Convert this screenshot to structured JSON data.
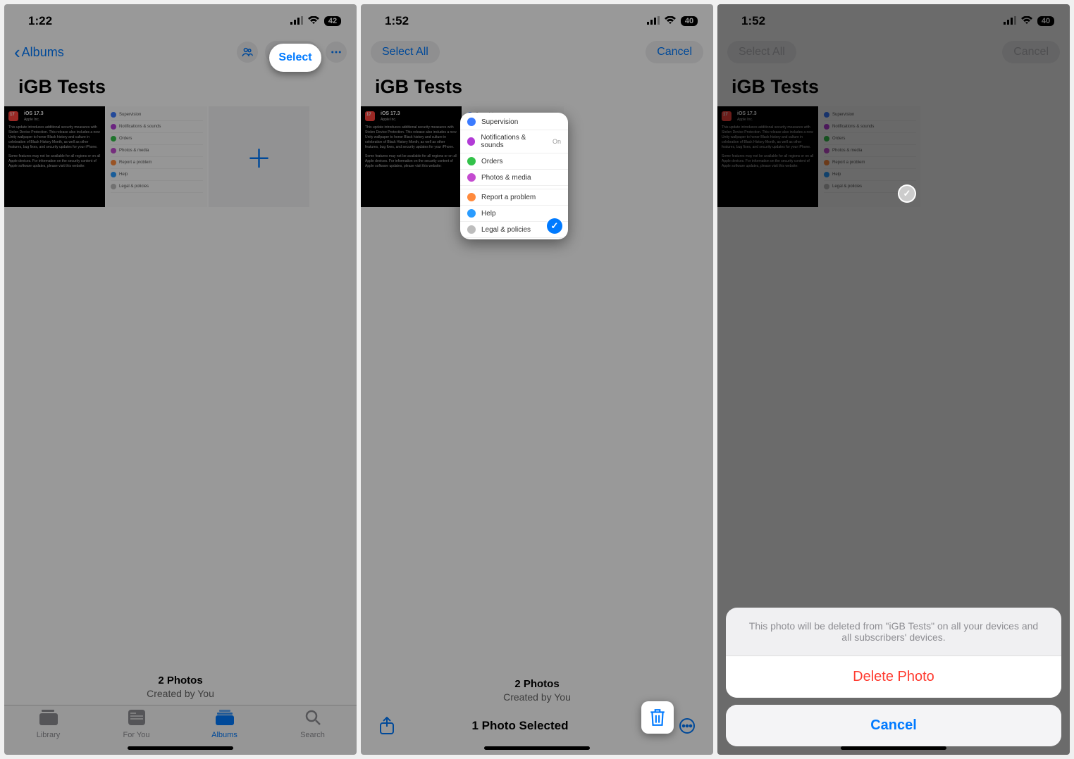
{
  "screens": {
    "s1": {
      "time": "1:22",
      "battery": "42",
      "back_label": "Albums",
      "select_label": "Select",
      "album_title": "iGB Tests",
      "footer_count": "2 Photos",
      "footer_by": "Created by You",
      "tabs": {
        "library": "Library",
        "foryou": "For You",
        "albums": "Albums",
        "search": "Search"
      }
    },
    "s2": {
      "time": "1:52",
      "battery": "40",
      "select_all": "Select All",
      "cancel": "Cancel",
      "album_title": "iGB Tests",
      "footer_count": "2 Photos",
      "footer_by": "Created by You",
      "selected_text": "1 Photo Selected",
      "popout_rows": [
        {
          "label": "Supervision",
          "color": "#3b7bff"
        },
        {
          "label": "Notifications & sounds",
          "color": "#b23bd6",
          "trail": "On"
        },
        {
          "label": "Orders",
          "color": "#33c24a"
        },
        {
          "label": "Photos & media",
          "color": "#c44bd0"
        },
        {
          "label": "Report a problem",
          "color": "#ff8a3d"
        },
        {
          "label": "Help",
          "color": "#2a9cff"
        },
        {
          "label": "Legal & policies",
          "color": "#bdbdbd"
        }
      ]
    },
    "s3": {
      "time": "1:52",
      "battery": "40",
      "select_all": "Select All",
      "cancel": "Cancel",
      "album_title": "iGB Tests",
      "sheet_msg": "This photo will be deleted from \"iGB Tests\" on all your devices and all subscribers' devices.",
      "delete_btn": "Delete Photo",
      "cancel_btn": "Cancel"
    },
    "thumb_update": {
      "title": "iOS 17.3",
      "vendor": "Apple Inc.",
      "body1": "This update introduces additional security measures with Stolen Device Protection. This release also includes a new Unity wallpaper to honor Black history and culture in celebration of Black History Month, as well as other features, bug fixes, and security updates for your iPhone.",
      "body2": "Some features may not be available for all regions or on all Apple devices. For information on the security content of Apple software updates, please visit this website:"
    },
    "thumb_settings_rows": [
      {
        "label": "Supervision",
        "color": "#3b7bff"
      },
      {
        "label": "Notifications & sounds",
        "color": "#b23bd6"
      },
      {
        "label": "Orders",
        "color": "#33c24a"
      },
      {
        "label": "Photos & media",
        "color": "#c44bd0"
      },
      {
        "label": "Report a problem",
        "color": "#ff8a3d"
      },
      {
        "label": "Help",
        "color": "#2a9cff"
      },
      {
        "label": "Legal & policies",
        "color": "#bdbdbd"
      }
    ],
    "colors": {
      "accent": "#007aff",
      "danger": "#ff3b30"
    }
  }
}
